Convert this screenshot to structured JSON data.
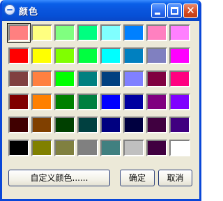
{
  "window": {
    "title": "颜色"
  },
  "titlebar_buttons": {
    "minimize": "minimize-icon",
    "maximize": "maximize-icon",
    "close": "close-icon",
    "close_glyph": "✕"
  },
  "colors": [
    [
      "#ff8080",
      "#ffff80",
      "#80ff80",
      "#00ff80",
      "#80ffff",
      "#0080ff",
      "#ff80c0",
      "#ff80ff"
    ],
    [
      "#ff0000",
      "#ffff00",
      "#80ff00",
      "#00ff40",
      "#00ffff",
      "#0080c0",
      "#8080c0",
      "#ff00ff"
    ],
    [
      "#804040",
      "#ff8040",
      "#00ff00",
      "#008080",
      "#004080",
      "#8080ff",
      "#800040",
      "#ff0080"
    ],
    [
      "#800000",
      "#ff8000",
      "#008000",
      "#008040",
      "#0000ff",
      "#0000a0",
      "#800080",
      "#8000ff"
    ],
    [
      "#400000",
      "#804000",
      "#004000",
      "#004040",
      "#000080",
      "#000040",
      "#400040",
      "#400080"
    ],
    [
      "#000000",
      "#808000",
      "#808040",
      "#808080",
      "#408080",
      "#c0c0c0",
      "#400040",
      "#ffffff"
    ]
  ],
  "buttons": {
    "custom": "自定义颜色......",
    "ok": "确定",
    "cancel": "取消"
  }
}
